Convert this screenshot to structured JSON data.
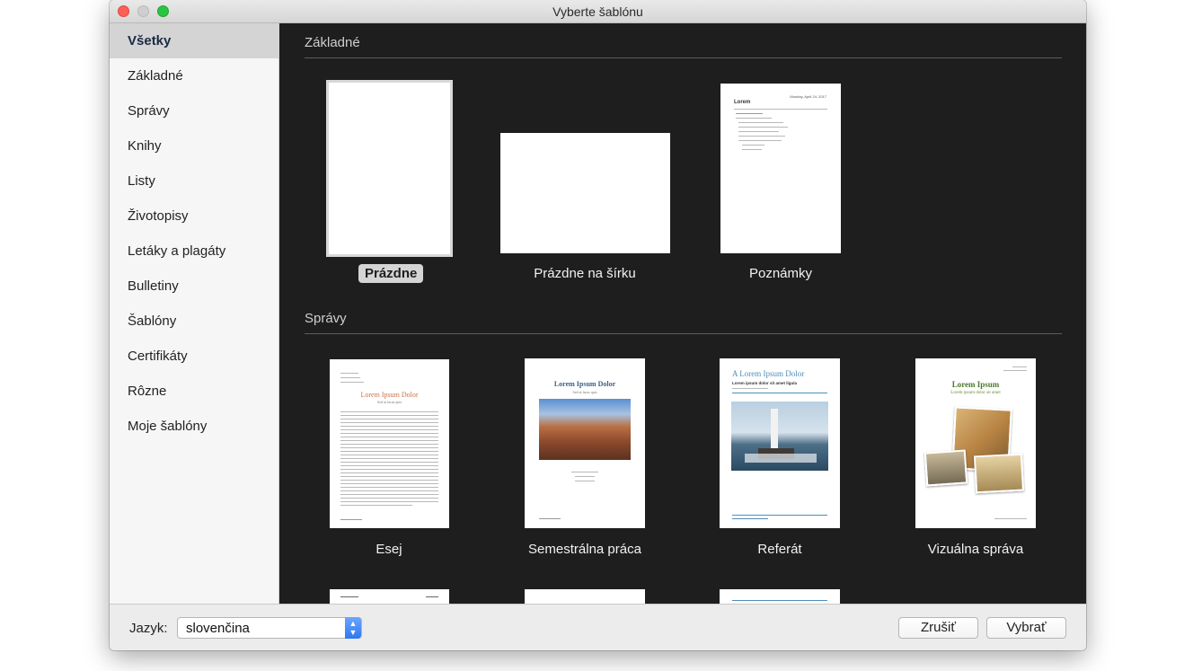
{
  "window": {
    "title": "Vyberte šablónu"
  },
  "sidebar": {
    "items": [
      {
        "label": "Všetky"
      },
      {
        "label": "Základné"
      },
      {
        "label": "Správy"
      },
      {
        "label": "Knihy"
      },
      {
        "label": "Listy"
      },
      {
        "label": "Životopisy"
      },
      {
        "label": "Letáky a plagáty"
      },
      {
        "label": "Bulletiny"
      },
      {
        "label": "Šablóny"
      },
      {
        "label": "Certifikáty"
      },
      {
        "label": "Rôzne"
      },
      {
        "label": "Moje šablóny"
      }
    ],
    "selected": "Všetky"
  },
  "sections": {
    "basic": {
      "title": "Základné",
      "templates": [
        {
          "label": "Prázdne"
        },
        {
          "label": "Prázdne na šírku"
        },
        {
          "label": "Poznámky",
          "heading": "Lorem",
          "date": "Monday, April 24, 2017"
        }
      ],
      "selected": "Prázdne"
    },
    "reports": {
      "title": "Správy",
      "templates": [
        {
          "label": "Esej",
          "heading": "Lorem Ipsum Dolor",
          "subheading": "Sed ut lacus quis"
        },
        {
          "label": "Semestrálna práca",
          "heading": "Lorem Ipsum Dolor",
          "subheading": "Sed ut lacus quis"
        },
        {
          "label": "Referát",
          "heading": "A Lorem Ipsum Dolor",
          "subheading": "Lorem ipsum dolor sit amet ligula"
        },
        {
          "label": "Vizuálna správa",
          "heading": "Lorem Ipsum",
          "subheading": "Lorem ipsum dolor sit amet"
        }
      ]
    }
  },
  "footer": {
    "language_label": "Jazyk:",
    "language_value": "slovenčina",
    "cancel_label": "Zrušiť",
    "choose_label": "Vybrať"
  },
  "colors": {
    "content_bg": "#1e1e1e",
    "select_accent": "#2f77f0",
    "essay_accent": "#c8734a",
    "term_accent": "#3c5f86",
    "report_accent": "#4a90b8",
    "visual_accent": "#4b7a2e"
  }
}
